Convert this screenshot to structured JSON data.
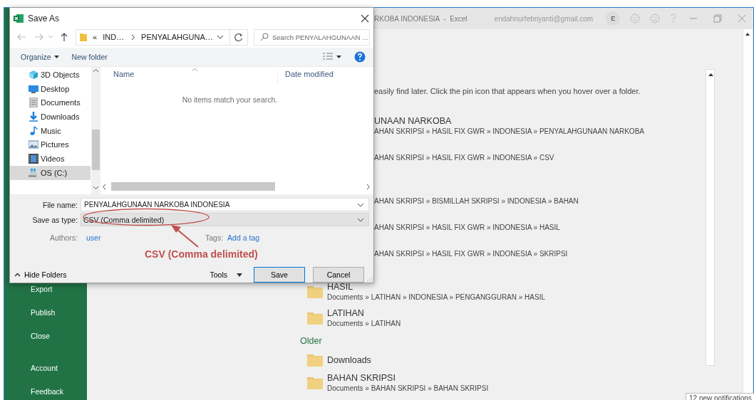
{
  "excel_window": {
    "title": "RKOBA INDONESIA  -  Excel",
    "account": "endahnurfebriyanti@gmail.com",
    "avatar": "E"
  },
  "sidebar": {
    "items_top": [
      {
        "label": "Export"
      },
      {
        "label": "Publish"
      },
      {
        "label": "Close"
      }
    ],
    "items_bottom": [
      {
        "label": "Account"
      },
      {
        "label": "Feedback"
      }
    ]
  },
  "recent": {
    "hint": "easily find later. Click the pin icon that appears when you hover over a folder.",
    "groups": [
      {
        "items": [
          {
            "kind": "clipped",
            "title": "UNAAN NARKOBA",
            "path": "AHAN SKRIPSI » HASIL FIX GWR » INDONESIA » PENYALAHGUNAAN NARKOBA"
          },
          {
            "kind": "clipped",
            "path": "AHAN SKRIPSI » HASIL FIX GWR » INDONESIA » CSV"
          }
        ]
      },
      {
        "items": [
          {
            "kind": "clipped",
            "path": "AHAN SKRIPSI » BISMILLAH SKRIPSI » INDONESIA » BAHAN"
          },
          {
            "kind": "clipped",
            "path": "AHAN SKRIPSI » HASIL FIX GWR » INDONESIA » HASIL"
          },
          {
            "kind": "clipped",
            "path": "AHAN SKRIPSI » HASIL FIX GWR » INDONESIA » SKRIPSI"
          }
        ]
      },
      {
        "items": [
          {
            "kind": "folder",
            "title": "HASIL",
            "path": "Documents » LATIHAN » INDONESIA » PENGANGGURAN » HASIL"
          },
          {
            "kind": "folder",
            "title": "LATIHAN",
            "path": "Documents » LATIHAN"
          }
        ]
      },
      {
        "heading": "Older",
        "items": [
          {
            "kind": "folder",
            "title": "Downloads"
          },
          {
            "kind": "folder",
            "title": "BAHAN SKRIPSI",
            "path": "Documents » BAHAN SKRIPSI » BAHAN SKRIPSI"
          }
        ]
      }
    ]
  },
  "notification": "12 new notifications",
  "dialog": {
    "title": "Save As",
    "breadcrumb": {
      "overflow": "«",
      "parent": "IND…",
      "current": "PENYALAHGUNA…"
    },
    "search": {
      "placeholder": "Search PENYALAHGUNAAN …"
    },
    "toolbar": {
      "organize": "Organize",
      "new_folder": "New folder"
    },
    "tree": [
      {
        "label": "3D Objects",
        "selected": false
      },
      {
        "label": "Desktop",
        "selected": false
      },
      {
        "label": "Documents",
        "selected": false
      },
      {
        "label": "Downloads",
        "selected": false
      },
      {
        "label": "Music",
        "selected": false
      },
      {
        "label": "Pictures",
        "selected": false
      },
      {
        "label": "Videos",
        "selected": false
      },
      {
        "label": "OS (C:)",
        "selected": true
      }
    ],
    "columns": [
      "Name",
      "Date modified"
    ],
    "empty_message": "No items match your search.",
    "file_name": {
      "label": "File name:",
      "value": "PENYALAHGUNAAN NARKOBA INDONESIA"
    },
    "save_as_type": {
      "label": "Save as type:",
      "value": "CSV (Comma delimited)"
    },
    "authors": {
      "label": "Authors:",
      "value": "user"
    },
    "tags": {
      "label": "Tags:",
      "value": "Add a tag"
    },
    "hide_folders": "Hide Folders",
    "tools": "Tools",
    "buttons": [
      {
        "label": "Save",
        "default": true
      },
      {
        "label": "Cancel",
        "default": false
      }
    ],
    "annotation": {
      "text": "CSV (Comma delimited)"
    }
  }
}
